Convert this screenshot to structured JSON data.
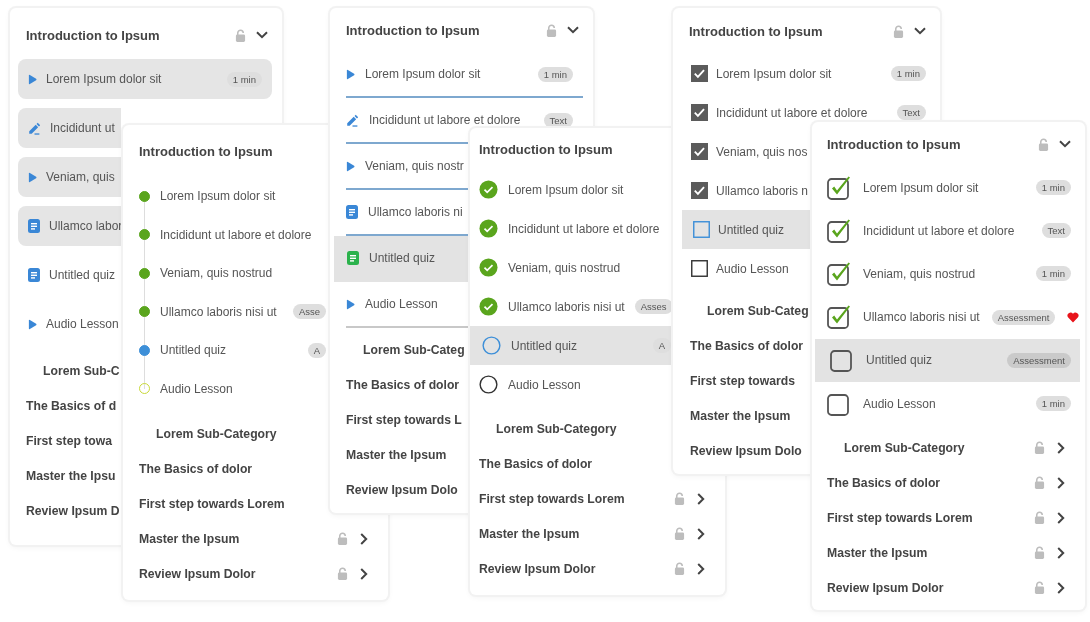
{
  "panels": [
    {
      "kind": "pill",
      "title": "Introduction to Ipsum",
      "locked": true,
      "collapsible": true,
      "lessons": [
        {
          "label": "Lorem Ipsum dolor sit",
          "kind": "video",
          "done": true,
          "badge": "1 min"
        },
        {
          "label": "Incididunt ut",
          "kind": "text",
          "done": true
        },
        {
          "label": "Veniam, quis",
          "kind": "video",
          "done": true
        },
        {
          "label": "Ullamco labor",
          "kind": "document",
          "done": true
        },
        {
          "label": "Untitled quiz",
          "kind": "document",
          "done": false
        },
        {
          "label": "Audio Lesson",
          "kind": "video",
          "done": false
        }
      ],
      "sections": [
        {
          "label": "Lorem Sub-C",
          "sub": true
        },
        {
          "label": "The Basics of d",
          "sub": false
        },
        {
          "label": "First step towa",
          "sub": false
        },
        {
          "label": "Master the Ipsu",
          "sub": false
        },
        {
          "label": "Review Ipsum D",
          "sub": false
        }
      ]
    },
    {
      "kind": "timeline",
      "title": "Introduction to Ipsum",
      "locked": false,
      "collapsible": false,
      "lessons": [
        {
          "label": "Lorem Ipsum dolor sit",
          "completed": true,
          "selected": false
        },
        {
          "label": "Incididunt ut labore et dolore",
          "completed": true,
          "selected": false
        },
        {
          "label": "Veniam, quis nostrud",
          "completed": true,
          "selected": false
        },
        {
          "label": "Ullamco laboris nisi ut",
          "completed": true,
          "selected": false,
          "badge": "Asse"
        },
        {
          "label": "Untitled quiz",
          "completed": false,
          "selected": true,
          "badge": "A"
        },
        {
          "label": "Audio Lesson",
          "completed": false,
          "selected": false
        }
      ],
      "sections": [
        {
          "label": "Lorem Sub-Category",
          "sub": true
        },
        {
          "label": "The Basics of dolor",
          "sub": false
        },
        {
          "label": "First step towards Lorem",
          "sub": false
        },
        {
          "label": "Master the Ipsum",
          "sub": false,
          "locked": true,
          "expandable": true
        },
        {
          "label": "Review Ipsum Dolor",
          "sub": false,
          "locked": true,
          "expandable": true
        }
      ]
    },
    {
      "kind": "underline",
      "title": "Introduction to Ipsum",
      "locked": true,
      "collapsible": true,
      "lessons": [
        {
          "label": "Lorem Ipsum dolor sit",
          "kind": "video",
          "done": true,
          "selected": false,
          "badge": "1 min"
        },
        {
          "label": "Incididunt ut labore et dolore",
          "kind": "text",
          "done": true,
          "selected": false,
          "badge": "Text"
        },
        {
          "label": "Veniam, quis nostr",
          "kind": "video",
          "done": true,
          "selected": false
        },
        {
          "label": "Ullamco laboris ni",
          "kind": "document",
          "done": true,
          "selected": false
        },
        {
          "label": "Untitled quiz",
          "kind": "document",
          "done": false,
          "selected": true
        },
        {
          "label": "Audio Lesson",
          "kind": "video",
          "done": false,
          "selected": false
        }
      ],
      "sections": [
        {
          "label": "Lorem Sub-Categ",
          "sub": true
        },
        {
          "label": "The Basics of dolor",
          "sub": false
        },
        {
          "label": "First step towards L",
          "sub": false
        },
        {
          "label": "Master the Ipsum",
          "sub": false
        },
        {
          "label": "Review Ipsum Dolo",
          "sub": false
        }
      ]
    },
    {
      "kind": "circle",
      "title": "Introduction to Ipsum",
      "locked": false,
      "collapsible": false,
      "lessons": [
        {
          "label": "Lorem Ipsum dolor sit",
          "completed": true,
          "selected": false
        },
        {
          "label": "Incididunt ut labore et dolore",
          "completed": true,
          "selected": false
        },
        {
          "label": "Veniam, quis nostrud",
          "completed": true,
          "selected": false
        },
        {
          "label": "Ullamco laboris nisi ut",
          "completed": true,
          "selected": false,
          "badge": "Asses"
        },
        {
          "label": "Untitled quiz",
          "completed": false,
          "selected": true,
          "badge": "A"
        },
        {
          "label": "Audio Lesson",
          "completed": false,
          "selected": false
        }
      ],
      "sections": [
        {
          "label": "Lorem Sub-Category",
          "sub": true
        },
        {
          "label": "The Basics of dolor",
          "sub": false
        },
        {
          "label": "First step towards Lorem",
          "sub": false,
          "locked": true,
          "expandable": true
        },
        {
          "label": "Master the Ipsum",
          "sub": false,
          "locked": true,
          "expandable": true
        },
        {
          "label": "Review Ipsum Dolor",
          "sub": false,
          "locked": true,
          "expandable": true
        }
      ]
    },
    {
      "kind": "checkbox",
      "title": "Introduction to Ipsum",
      "locked": true,
      "collapsible": true,
      "lessons": [
        {
          "label": "Lorem Ipsum dolor sit",
          "checked": true,
          "selected": false,
          "badge": "1 min"
        },
        {
          "label": "Incididunt ut labore et dolore",
          "checked": true,
          "selected": false,
          "badge": "Text"
        },
        {
          "label": "Veniam, quis nos",
          "checked": true,
          "selected": false
        },
        {
          "label": "Ullamco laboris n",
          "checked": true,
          "selected": false
        },
        {
          "label": "Untitled quiz",
          "checked": false,
          "selected": true
        },
        {
          "label": "Audio Lesson",
          "checked": false,
          "selected": false
        }
      ],
      "sections": [
        {
          "label": "Lorem Sub-Categ",
          "sub": true
        },
        {
          "label": "The Basics of dolor",
          "sub": false
        },
        {
          "label": "First step towards",
          "sub": false
        },
        {
          "label": "Master the Ipsum",
          "sub": false
        },
        {
          "label": "Review Ipsum Dolo",
          "sub": false
        }
      ]
    },
    {
      "kind": "bigcheck",
      "title": "Introduction to Ipsum",
      "locked": true,
      "collapsible": true,
      "lessons": [
        {
          "label": "Lorem Ipsum dolor sit",
          "checked": true,
          "selected": false,
          "badge": "1 min",
          "favorite": false
        },
        {
          "label": "Incididunt ut labore et dolore",
          "checked": true,
          "selected": false,
          "badge": "Text",
          "favorite": false
        },
        {
          "label": "Veniam, quis nostrud",
          "checked": true,
          "selected": false,
          "badge": "1 min",
          "favorite": false
        },
        {
          "label": "Ullamco laboris nisi ut",
          "checked": true,
          "selected": false,
          "badge": "Assessment",
          "favorite": true
        },
        {
          "label": "Untitled quiz",
          "checked": false,
          "selected": true,
          "badge": "Assessment",
          "favorite": false
        },
        {
          "label": "Audio Lesson",
          "checked": false,
          "selected": false,
          "badge": "1 min",
          "favorite": false
        }
      ],
      "sections": [
        {
          "label": "Lorem Sub-Category",
          "sub": true,
          "locked": true,
          "expandable": true
        },
        {
          "label": "The Basics of dolor",
          "sub": false,
          "locked": true,
          "expandable": true
        },
        {
          "label": "First step towards Lorem",
          "sub": false,
          "locked": true,
          "expandable": true
        },
        {
          "label": "Master the Ipsum",
          "sub": false,
          "locked": true,
          "expandable": true
        },
        {
          "label": "Review Ipsum Dolor",
          "sub": false,
          "locked": true,
          "expandable": true
        }
      ]
    }
  ]
}
